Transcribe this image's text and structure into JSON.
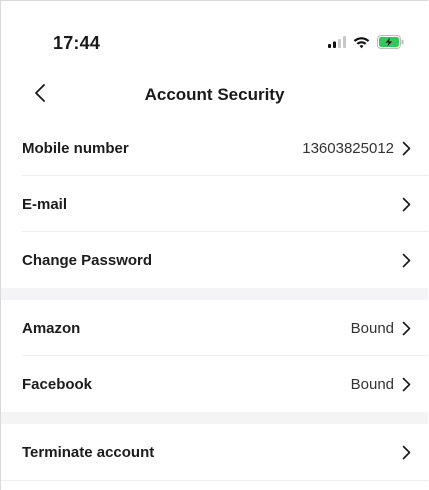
{
  "status_bar": {
    "time": "17:44",
    "icons": [
      "signal-icon",
      "wifi-icon",
      "battery-charging-icon"
    ],
    "battery_color": "#34c759"
  },
  "nav": {
    "back_icon": "chevron-left-icon",
    "title": "Account Security"
  },
  "sections": [
    {
      "rows": [
        {
          "label": "Mobile number",
          "value": "13603825012"
        },
        {
          "label": "E-mail",
          "value": ""
        },
        {
          "label": "Change Password",
          "value": ""
        }
      ]
    },
    {
      "rows": [
        {
          "label": "Amazon",
          "value": "Bound"
        },
        {
          "label": "Facebook",
          "value": "Bound"
        }
      ]
    },
    {
      "rows": [
        {
          "label": "Terminate account",
          "value": ""
        }
      ]
    }
  ],
  "colors": {
    "section_gap": "#f4f4f6",
    "divider": "#eeeeee"
  }
}
